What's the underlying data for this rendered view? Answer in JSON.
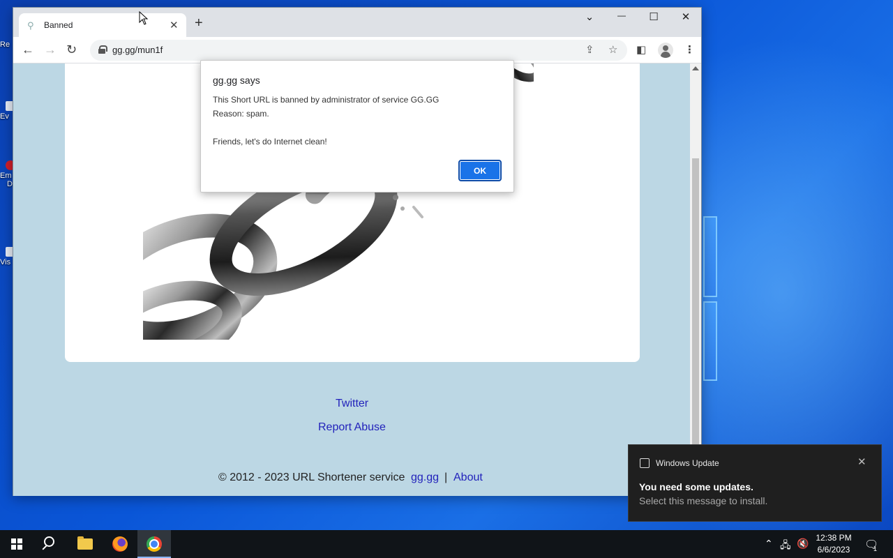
{
  "desktop": {
    "icons": [
      {
        "label": "Re"
      },
      {
        "label": "Ev"
      },
      {
        "label": "Em"
      },
      {
        "label": "D"
      },
      {
        "label": "Vis"
      }
    ]
  },
  "browser": {
    "tab_title": "Banned",
    "tab_close": "✕",
    "new_tab": "+",
    "url": "gg.gg/mun1f",
    "window_controls": {
      "tabsearch": "⌄",
      "minimize": "—",
      "maximize": "☐",
      "close": "✕"
    }
  },
  "dialog": {
    "title": "gg.gg says",
    "lines": [
      "This Short URL is banned by administrator of service GG.GG",
      "Reason: spam.",
      "Friends, let's do Internet clean!"
    ],
    "ok_label": "OK"
  },
  "page": {
    "links": {
      "twitter": "Twitter",
      "report_abuse": "Report Abuse"
    },
    "footer": {
      "copyright": "© 2012 - 2023 URL Shortener service",
      "site_link": "gg.gg",
      "separator": "|",
      "about_link": "About"
    }
  },
  "notification": {
    "app": "Windows Update",
    "title": "You need some updates.",
    "body": "Select this message to install.",
    "close": "✕"
  },
  "taskbar": {
    "time": "12:38 PM",
    "date": "6/6/2023",
    "notification_count": "1"
  }
}
